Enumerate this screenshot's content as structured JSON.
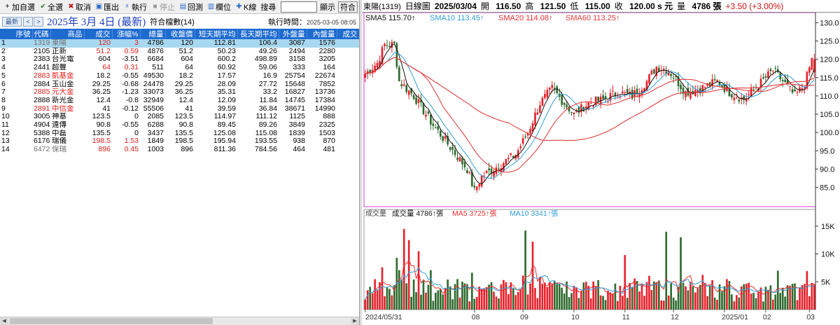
{
  "toolbar": {
    "add_watch": "加自選",
    "select_all": "全選",
    "cancel": "取消",
    "export": "匯出",
    "execute": "執行",
    "stop": "停止",
    "backtest": "回測",
    "columns": "欄位",
    "kline": "K線",
    "search": "搜尋",
    "show": "顯示",
    "match": "符合"
  },
  "datebar": {
    "newest_btn": "最新",
    "date": "2025年  3月  4日 (最新)",
    "match_count": "符合檔數(14)",
    "exec_time_label": "執行時間：",
    "exec_time": "2025-03-05 08:05"
  },
  "table": {
    "headers": [
      "序號",
      "代碼",
      "商品",
      "成交",
      "漲幅%",
      "總量",
      "收盤價",
      "短天期平均",
      "長天期平均",
      "外盤量",
      "內盤量",
      "成交"
    ],
    "rows": [
      [
        "1",
        "1319",
        "東陽",
        "120",
        "3",
        "4786",
        "120",
        "112.81",
        "106.4",
        "3087",
        "1576"
      ],
      [
        "2",
        "2105",
        "正新",
        "51.2",
        "0.59",
        "4876",
        "51.2",
        "50.23",
        "49.26",
        "2494",
        "2280"
      ],
      [
        "3",
        "2383",
        "台光電",
        "604",
        "-3.51",
        "6684",
        "604",
        "600.2",
        "498.89",
        "3158",
        "3205"
      ],
      [
        "4",
        "2441",
        "超豐",
        "64",
        "0.31",
        "511",
        "64",
        "60.92",
        "59.06",
        "333",
        "164"
      ],
      [
        "5",
        "2883",
        "凱基金",
        "18.2",
        "-0.55",
        "49530",
        "18.2",
        "17.57",
        "16.9",
        "25754",
        "22674"
      ],
      [
        "6",
        "2884",
        "玉山金",
        "29.25",
        "-0.68",
        "24478",
        "29.25",
        "28.09",
        "27.72",
        "15648",
        "7852"
      ],
      [
        "7",
        "2885",
        "元大金",
        "36.25",
        "-1.23",
        "33073",
        "36.25",
        "35.31",
        "33.2",
        "16827",
        "13736"
      ],
      [
        "8",
        "2888",
        "新光金",
        "12.4",
        "-0.8",
        "32949",
        "12.4",
        "12.09",
        "11.84",
        "14745",
        "17384"
      ],
      [
        "9",
        "2891",
        "中信金",
        "41",
        "-0.12",
        "55506",
        "41",
        "39.59",
        "36.84",
        "38671",
        "14990"
      ],
      [
        "10",
        "3005",
        "神基",
        "123.5",
        "0",
        "2085",
        "123.5",
        "114.97",
        "111.12",
        "1125",
        "888"
      ],
      [
        "11",
        "4904",
        "遠傳",
        "90.8",
        "-0.55",
        "6288",
        "90.8",
        "89.45",
        "89.26",
        "3849",
        "2325"
      ],
      [
        "12",
        "5388",
        "中磊",
        "135.5",
        "0",
        "3437",
        "135.5",
        "125.08",
        "115.08",
        "1839",
        "1503"
      ],
      [
        "13",
        "6176",
        "瑞儀",
        "198.5",
        "1.53",
        "1849",
        "198.5",
        "195.94",
        "193.55",
        "938",
        "870"
      ],
      [
        "14",
        "6472",
        "保瑞",
        "896",
        "0.45",
        "1003",
        "896",
        "811.36",
        "784.56",
        "464",
        "481"
      ]
    ],
    "red_name_rows": [
      4,
      6,
      8
    ],
    "red_trade_rows": [
      0,
      1,
      3,
      12,
      13
    ],
    "grey_name_rows": [
      0,
      13
    ]
  },
  "chart_header": {
    "name": "東陽(1319)",
    "type": "日線圖",
    "date": "2025/03/04",
    "open_label": "開",
    "open": "116.50",
    "high_label": "高",
    "high": "121.50",
    "low_label": "低",
    "low": "115.00",
    "close_label": "收",
    "close": "120.00 s 元",
    "vol_label": "量",
    "vol": "4786 張",
    "change": "+3.50 (+3.00%)"
  },
  "colors": {
    "up": "#e8202a",
    "down": "#2e6a2e",
    "sma5": "#111111",
    "sma10": "#2f9fd8",
    "sma20": "#e83030",
    "sma60": "#e03c3c",
    "header_blue": "#1e6bd0",
    "select": "#a8d8f0"
  },
  "chart_data": [
    {
      "type": "candlestick",
      "title": "",
      "legend": [
        {
          "name": "SMA5",
          "value": "115.70↑",
          "color": "#111111"
        },
        {
          "name": "SMA10",
          "value": "113.45↑",
          "color": "#2f9fd8"
        },
        {
          "name": "SMA20",
          "value": "114.08↑",
          "color": "#e83030"
        },
        {
          "name": "SMA60",
          "value": "113.25↑",
          "color": "#e03c3c"
        }
      ],
      "y_ticks": [
        85,
        90,
        95,
        100,
        105,
        110,
        115,
        120,
        125,
        130
      ],
      "y_tick_labels": [
        "85.0",
        "90.0",
        "95.0",
        "100.0",
        "105.0",
        "110.0",
        "115.0",
        "120.0",
        "125.0",
        "130.0"
      ],
      "ylim": [
        80.5,
        132
      ],
      "x_labels": [
        "2024/05/31",
        "08",
        "09",
        "10",
        "11",
        "12",
        "2025/01",
        "02",
        "03"
      ],
      "x_label_bars": [
        0,
        45,
        65,
        86,
        107,
        127,
        148,
        165,
        183
      ],
      "anchors_close": [
        [
          0,
          116
        ],
        [
          5,
          119
        ],
        [
          8,
          124
        ],
        [
          12,
          124
        ],
        [
          14,
          114
        ],
        [
          20,
          110
        ],
        [
          28,
          102
        ],
        [
          35,
          96
        ],
        [
          42,
          90
        ],
        [
          45,
          84
        ],
        [
          48,
          88
        ],
        [
          55,
          91
        ],
        [
          62,
          94
        ],
        [
          67,
          100
        ],
        [
          72,
          108
        ],
        [
          77,
          112
        ],
        [
          82,
          108
        ],
        [
          86,
          105
        ],
        [
          92,
          108
        ],
        [
          98,
          109
        ],
        [
          104,
          111
        ],
        [
          110,
          110
        ],
        [
          116,
          114
        ],
        [
          120,
          118
        ],
        [
          125,
          117
        ],
        [
          132,
          111
        ],
        [
          138,
          112
        ],
        [
          145,
          114
        ],
        [
          150,
          111
        ],
        [
          156,
          109
        ],
        [
          162,
          113
        ],
        [
          168,
          117
        ],
        [
          172,
          114
        ],
        [
          177,
          110
        ],
        [
          181,
          113
        ],
        [
          184,
          120
        ]
      ]
    },
    {
      "type": "bar",
      "title": "成交量",
      "legend": [
        {
          "name": "成交量",
          "value": "4786↑張",
          "color": "#111111"
        },
        {
          "name": "MA5",
          "value": "3725↑張",
          "color": "#e83030"
        },
        {
          "name": "MA10",
          "value": "3341↑張",
          "color": "#2f9fd8"
        }
      ],
      "y_ticks": [
        5000,
        10000,
        15000
      ],
      "y_tick_labels": [
        "5K",
        "10K",
        "15K"
      ],
      "ylim": [
        0,
        17500
      ],
      "volume_spikes": [
        [
          16,
          14500
        ],
        [
          18,
          12500
        ],
        [
          22,
          10500
        ],
        [
          66,
          14200
        ],
        [
          69,
          12200
        ],
        [
          107,
          9800
        ],
        [
          124,
          14000
        ],
        [
          130,
          13000
        ],
        [
          170,
          7000
        ],
        [
          184,
          4786
        ]
      ]
    }
  ]
}
